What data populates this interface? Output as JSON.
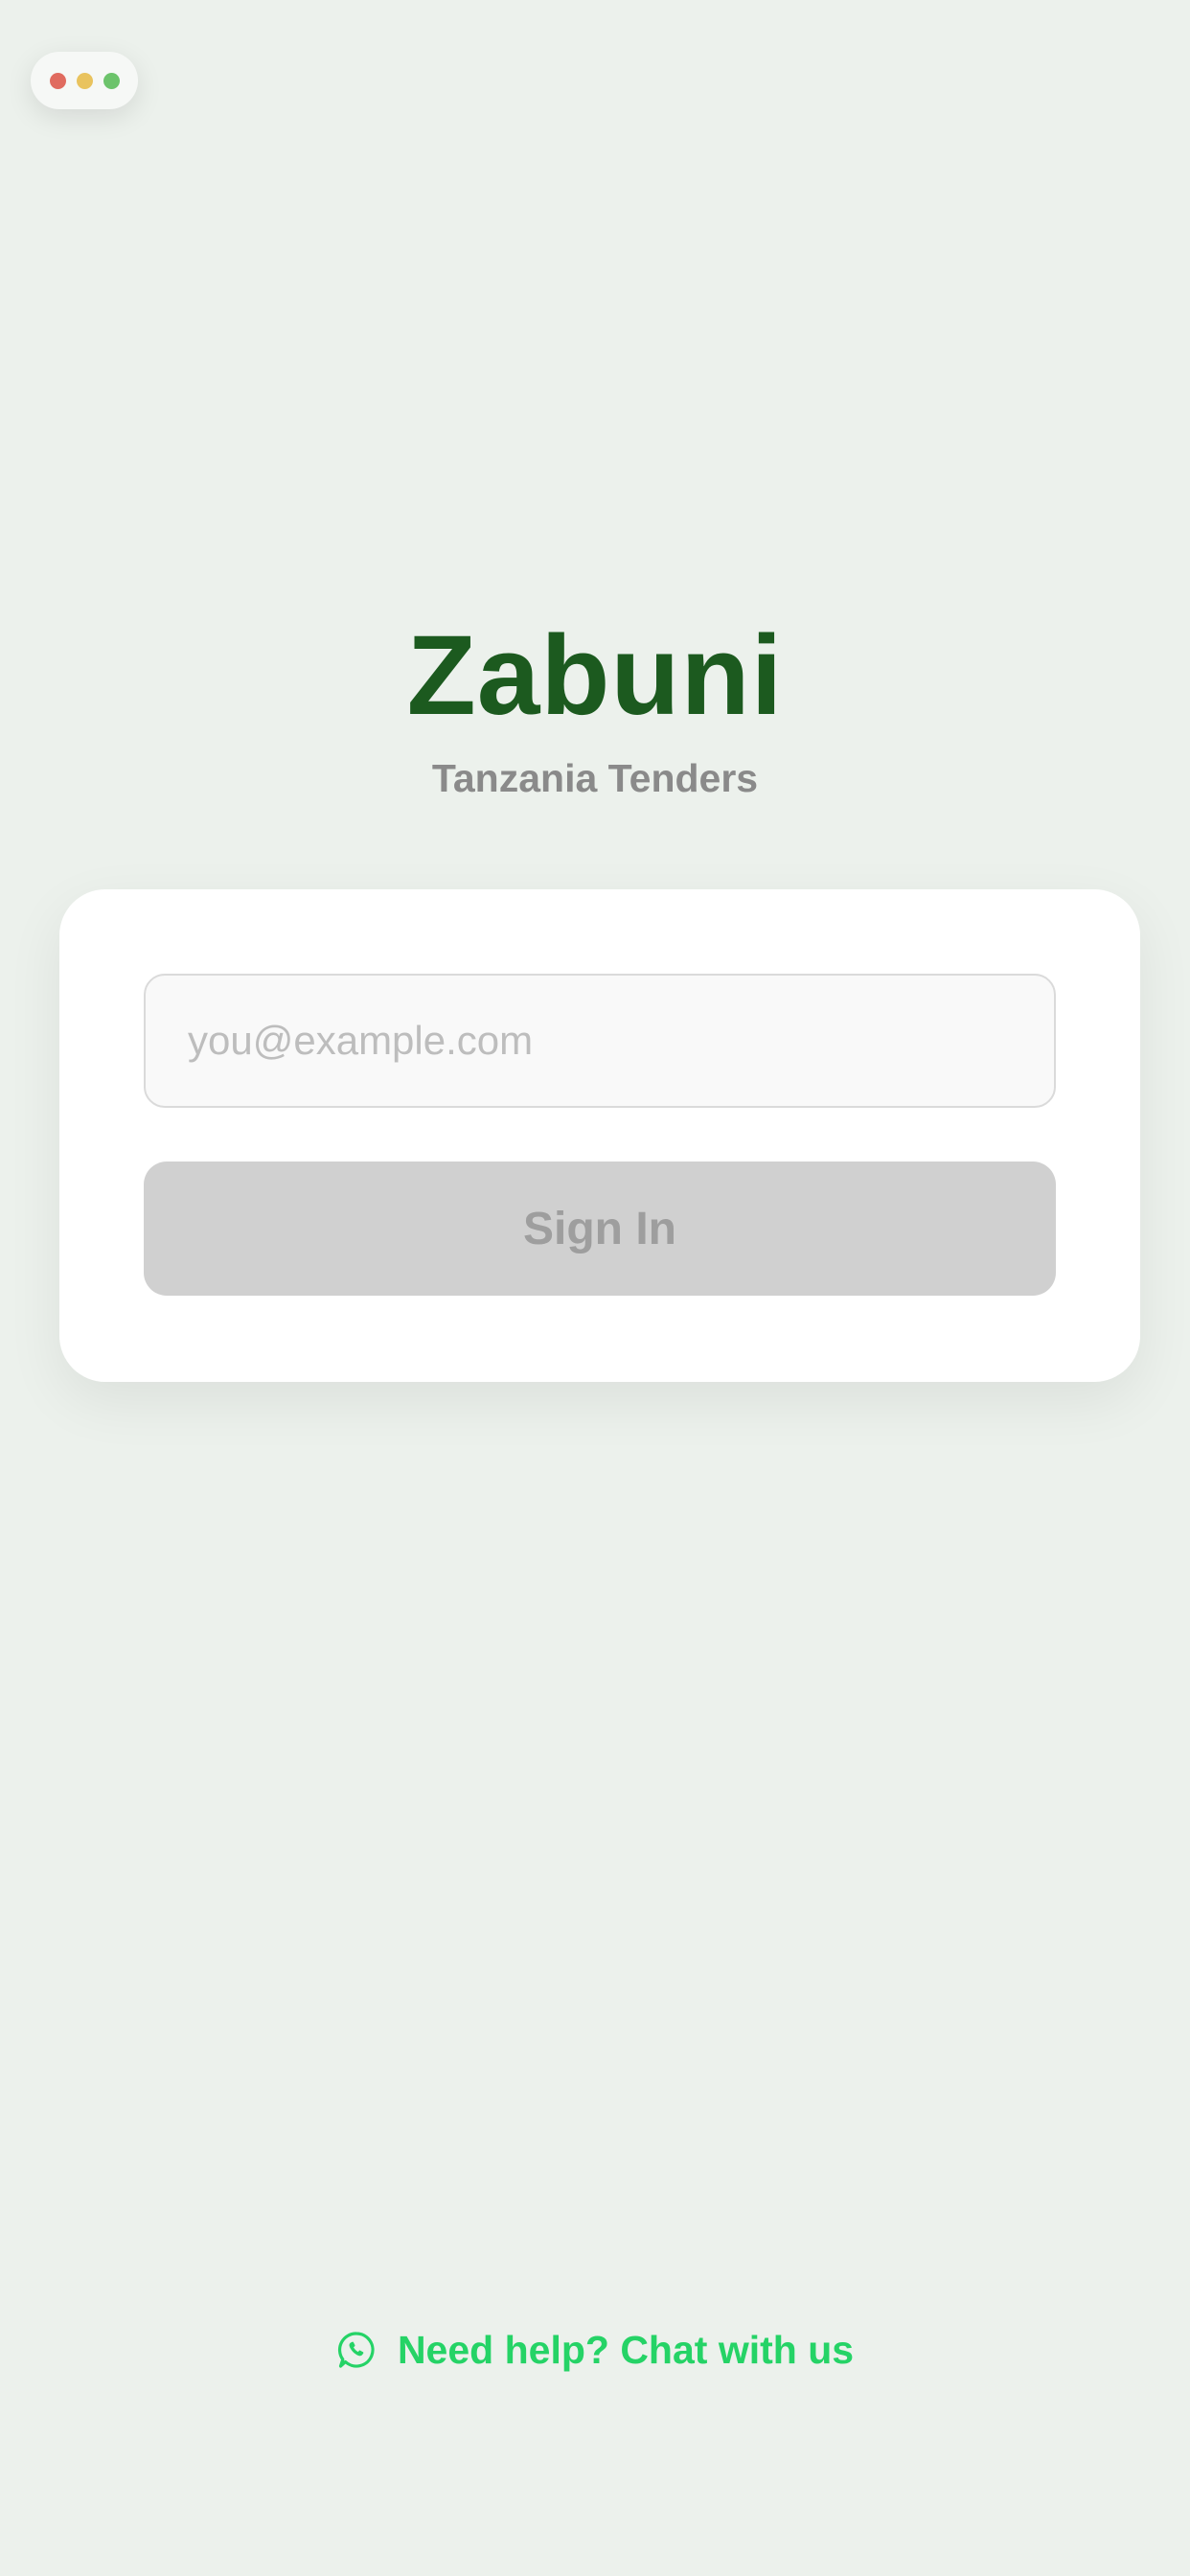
{
  "colors": {
    "background": "#ECF1EC",
    "brand_green": "#1C5A1F",
    "help_green": "#25D366",
    "button_disabled_bg": "#D0D0D0",
    "button_disabled_text": "#9E9E9E",
    "dot_red": "#E06B5F",
    "dot_yellow": "#E9C35E",
    "dot_green": "#6CC36B"
  },
  "window_controls": {
    "icons": [
      "close-dot",
      "minimize-dot",
      "maximize-dot"
    ]
  },
  "brand": {
    "title": "Zabuni",
    "subtitle": "Tanzania Tenders"
  },
  "login": {
    "email_placeholder": "you@example.com",
    "email_value": "",
    "sign_in_label": "Sign In",
    "sign_in_enabled": false
  },
  "help": {
    "icon": "whatsapp-icon",
    "label": "Need help? Chat with us"
  }
}
